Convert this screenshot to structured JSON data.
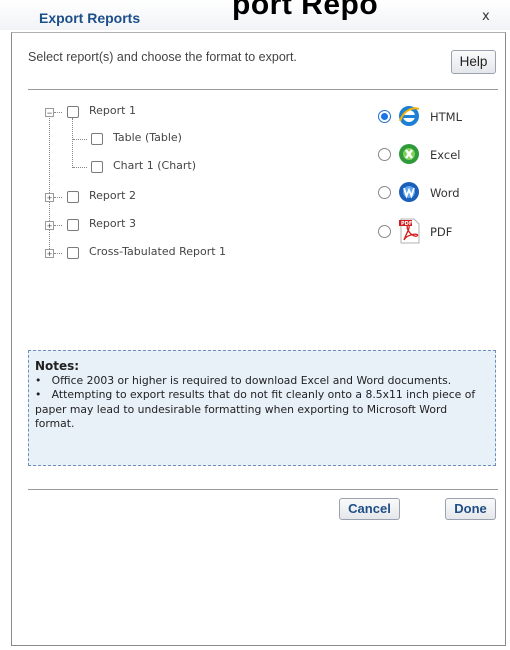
{
  "banner": "port Repo",
  "dialog": {
    "title": "Export Reports",
    "close": "x",
    "instruction": "Select report(s) and choose the format to export.",
    "help_label": "Help"
  },
  "tree": {
    "report1": {
      "label": "Report 1",
      "expander": "−",
      "checked": false
    },
    "table": {
      "label": "Table (Table)",
      "checked": false
    },
    "chart1": {
      "label": "Chart 1 (Chart)",
      "checked": false
    },
    "report2": {
      "label": "Report 2",
      "expander": "+",
      "checked": false
    },
    "report3": {
      "label": "Report 3",
      "expander": "+",
      "checked": false
    },
    "crosstab": {
      "label": "Cross-Tabulated Report 1",
      "expander": "+",
      "checked": false
    }
  },
  "formats": {
    "html": {
      "label": "HTML",
      "selected": true,
      "icon": "internet-explorer-icon"
    },
    "excel": {
      "label": "Excel",
      "selected": false,
      "icon": "excel-icon"
    },
    "word": {
      "label": "Word",
      "selected": false,
      "icon": "word-icon"
    },
    "pdf": {
      "label": "PDF",
      "selected": false,
      "icon": "pdf-icon"
    }
  },
  "notes": {
    "title": "Notes:",
    "bullet": "•",
    "item1": "Office 2003 or higher is required to download Excel and Word documents.",
    "item2": "Attempting to export results that do not fit cleanly onto a 8.5x11 inch piece of paper may lead to undesirable formatting when exporting to Microsoft Word format."
  },
  "footer": {
    "cancel_label": "Cancel",
    "done_label": "Done"
  },
  "colors": {
    "title": "#1c4f8a",
    "radio_selected": "#1a73e8",
    "notes_bg": "#e8f0f8",
    "notes_border": "#6d8fb8"
  }
}
